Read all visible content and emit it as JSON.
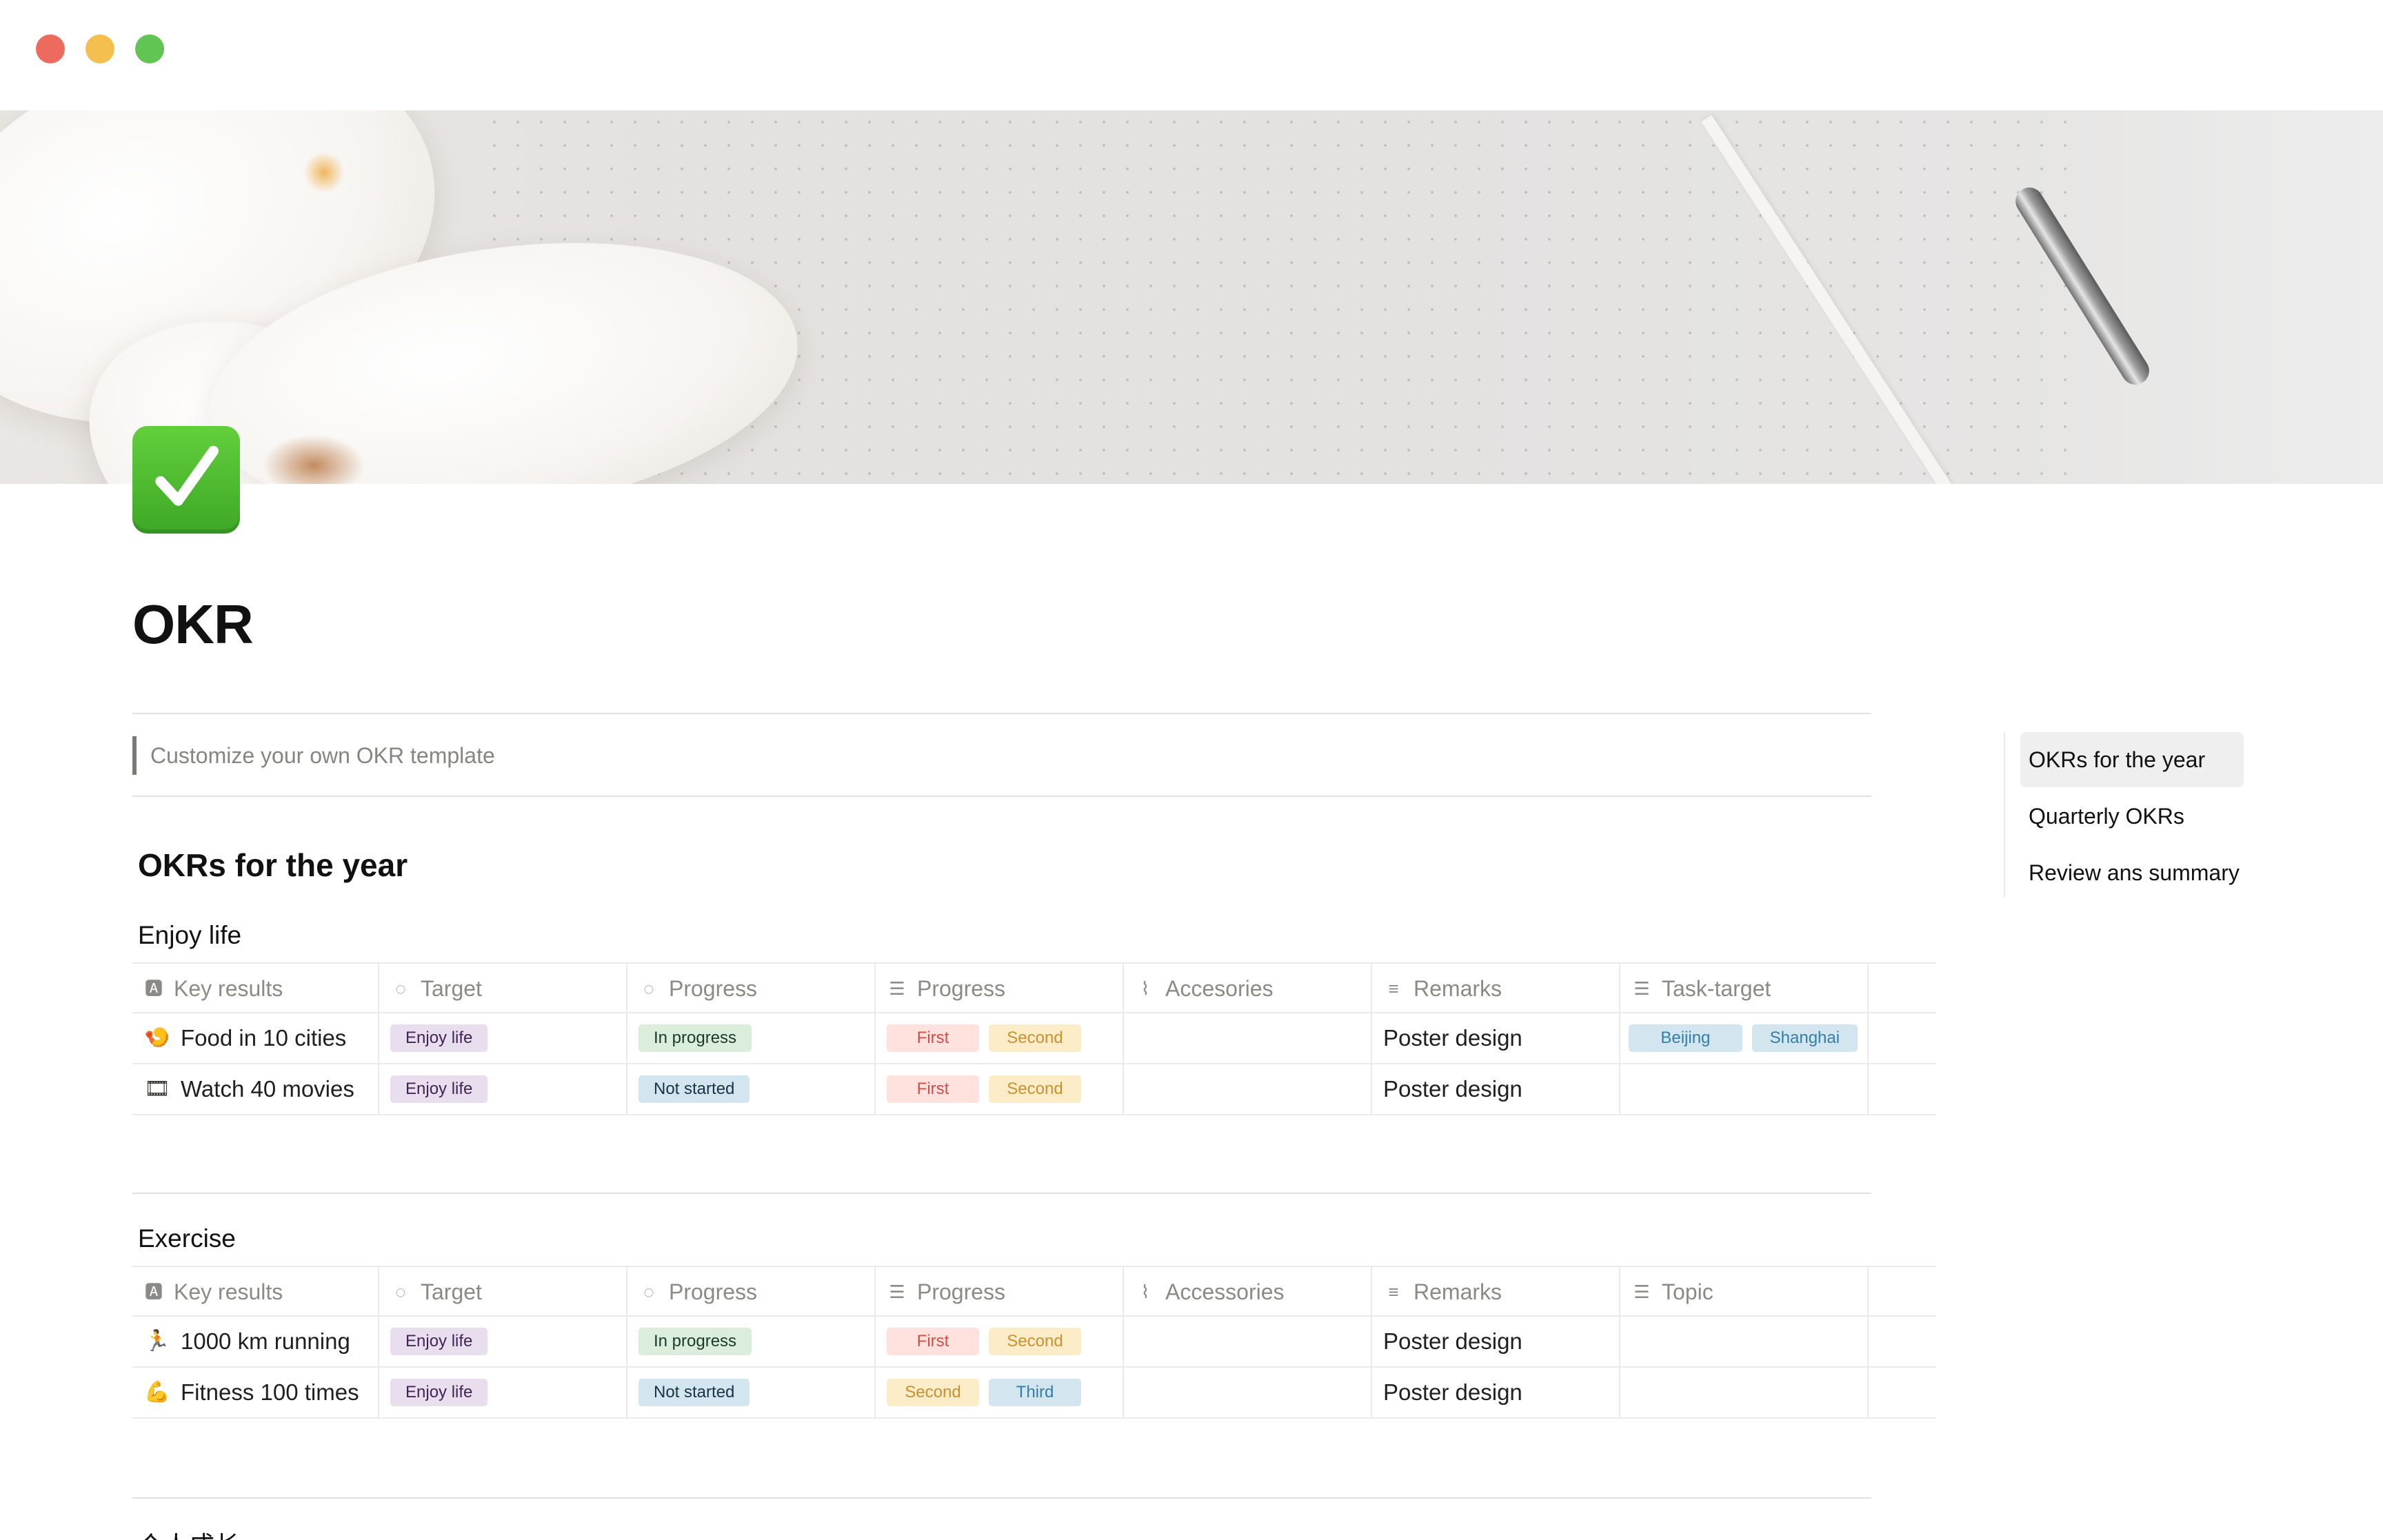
{
  "page": {
    "title": "OKR",
    "quote": "Customize your own OKR template",
    "icon": "check-mark-button-icon"
  },
  "toc": {
    "items": [
      "OKRs for the year",
      "Quarterly OKRs",
      "Review ans summary"
    ]
  },
  "section_year": {
    "heading": "OKRs for the year"
  },
  "enjoy_life": {
    "heading": "Enjoy life",
    "columns": [
      {
        "icon": "text-icon",
        "label": "Key results"
      },
      {
        "icon": "status-icon",
        "label": "Target"
      },
      {
        "icon": "status-icon",
        "label": "Progress"
      },
      {
        "icon": "multi-select-icon",
        "label": "Progress"
      },
      {
        "icon": "paperclip-icon",
        "label": "Accesories"
      },
      {
        "icon": "text-lines-icon",
        "label": "Remarks"
      },
      {
        "icon": "multi-select-icon",
        "label": "Task-target"
      }
    ],
    "rows": [
      {
        "emoji": "🍤",
        "name": "Food in 10 cities",
        "target": "Enjoy life",
        "status": "In progress",
        "stages": [
          "First",
          "Second"
        ],
        "remarks": "Poster design",
        "tasks": [
          "Beijing",
          "Shanghai"
        ]
      },
      {
        "emoji": "🎞",
        "name": "Watch 40 movies",
        "target": "Enjoy life",
        "status": "Not started",
        "stages": [
          "First",
          "Second"
        ],
        "remarks": "Poster design",
        "tasks": []
      }
    ]
  },
  "exercise": {
    "heading": "Exercise",
    "columns": [
      {
        "icon": "text-icon",
        "label": "Key results"
      },
      {
        "icon": "status-icon",
        "label": "Target"
      },
      {
        "icon": "status-icon",
        "label": "Progress"
      },
      {
        "icon": "multi-select-icon",
        "label": "Progress"
      },
      {
        "icon": "paperclip-icon",
        "label": "Accessories"
      },
      {
        "icon": "text-lines-icon",
        "label": "Remarks"
      },
      {
        "icon": "multi-select-icon",
        "label": "Topic"
      }
    ],
    "rows": [
      {
        "emoji": "🏃",
        "name": "1000 km running",
        "target": "Enjoy life",
        "status": "In progress",
        "stages": [
          "First",
          "Second"
        ],
        "remarks": "Poster design"
      },
      {
        "emoji": "💪",
        "name": "Fitness 100 times",
        "target": "Enjoy life",
        "status": "Not started",
        "stages": [
          "Second",
          "Third"
        ],
        "remarks": "Poster design"
      }
    ]
  },
  "next_heading": "个人成长"
}
